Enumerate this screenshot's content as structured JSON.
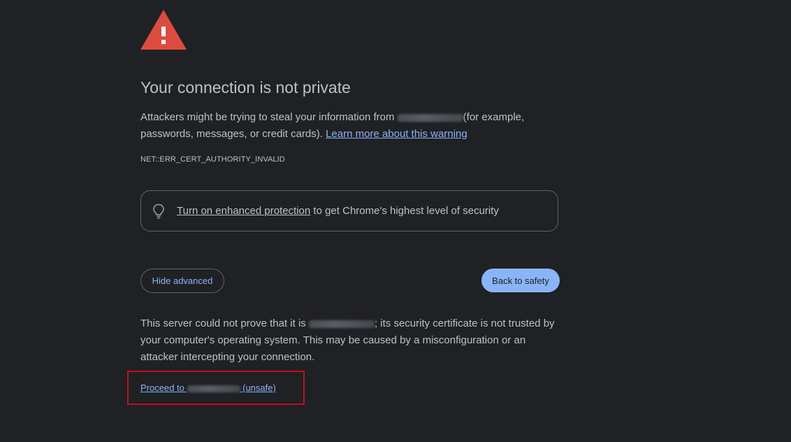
{
  "page": {
    "title": "Your connection is not private",
    "description_prefix": "Attackers might be trying to steal your information from ",
    "description_suffix": "(for example, passwords, messages, or credit cards). ",
    "learn_more_link": "Learn more about this warning",
    "error_code": "NET::ERR_CERT_AUTHORITY_INVALID"
  },
  "protection": {
    "link_text": "Turn on enhanced protection",
    "suffix_text": " to get Chrome's highest level of security",
    "icon": "lightbulb-icon"
  },
  "buttons": {
    "hide_advanced": "Hide advanced",
    "back_to_safety": "Back to safety"
  },
  "details": {
    "prefix": "This server could not prove that it is ",
    "suffix": "; its security certificate is not trusted by your computer's operating system. This may be caused by a misconfiguration or an attacker intercepting your connection."
  },
  "proceed": {
    "prefix": "Proceed to ",
    "suffix": " (unsafe)"
  },
  "colors": {
    "background": "#202124",
    "text": "#bdc1c6",
    "link": "#8ab4f8",
    "warning_icon": "#db4c3f",
    "highlight_box": "#c0111f"
  }
}
